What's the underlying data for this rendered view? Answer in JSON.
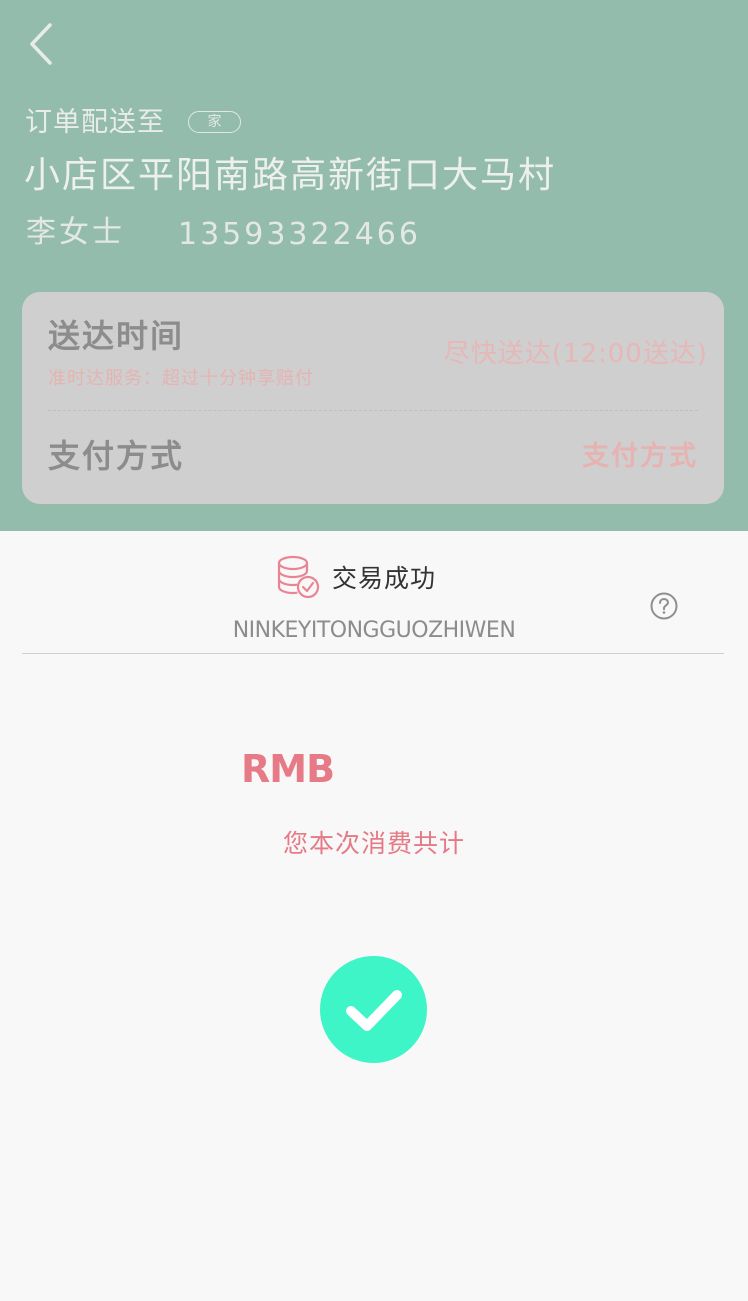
{
  "order": {
    "deliver_to_label": "订单配送至",
    "tag": "家",
    "address": "小店区平阳南路高新街口大马村",
    "contact_name": "李女士",
    "contact_phone": "13593322466"
  },
  "info_card": {
    "delivery_time_label": "送达时间",
    "delivery_time_sub": "准时达服务：超过十分钟享赔付",
    "delivery_time_value": "尽快送达(12:00送达)",
    "payment_label": "支付方式",
    "payment_value": "支付方式"
  },
  "sheet": {
    "title": "交易成功",
    "subtitle": "NINKEYITONGGUOZHIWEN",
    "currency": "RMB",
    "caption": "您本次消费共计"
  },
  "icons": {
    "back": "chevron-left-icon",
    "coins": "coins-check-icon",
    "help": "question-circle-icon",
    "success": "check-icon"
  },
  "colors": {
    "header_bg": "#93bcad",
    "accent_pink": "#e77a87",
    "success_green": "#3df5c6"
  }
}
